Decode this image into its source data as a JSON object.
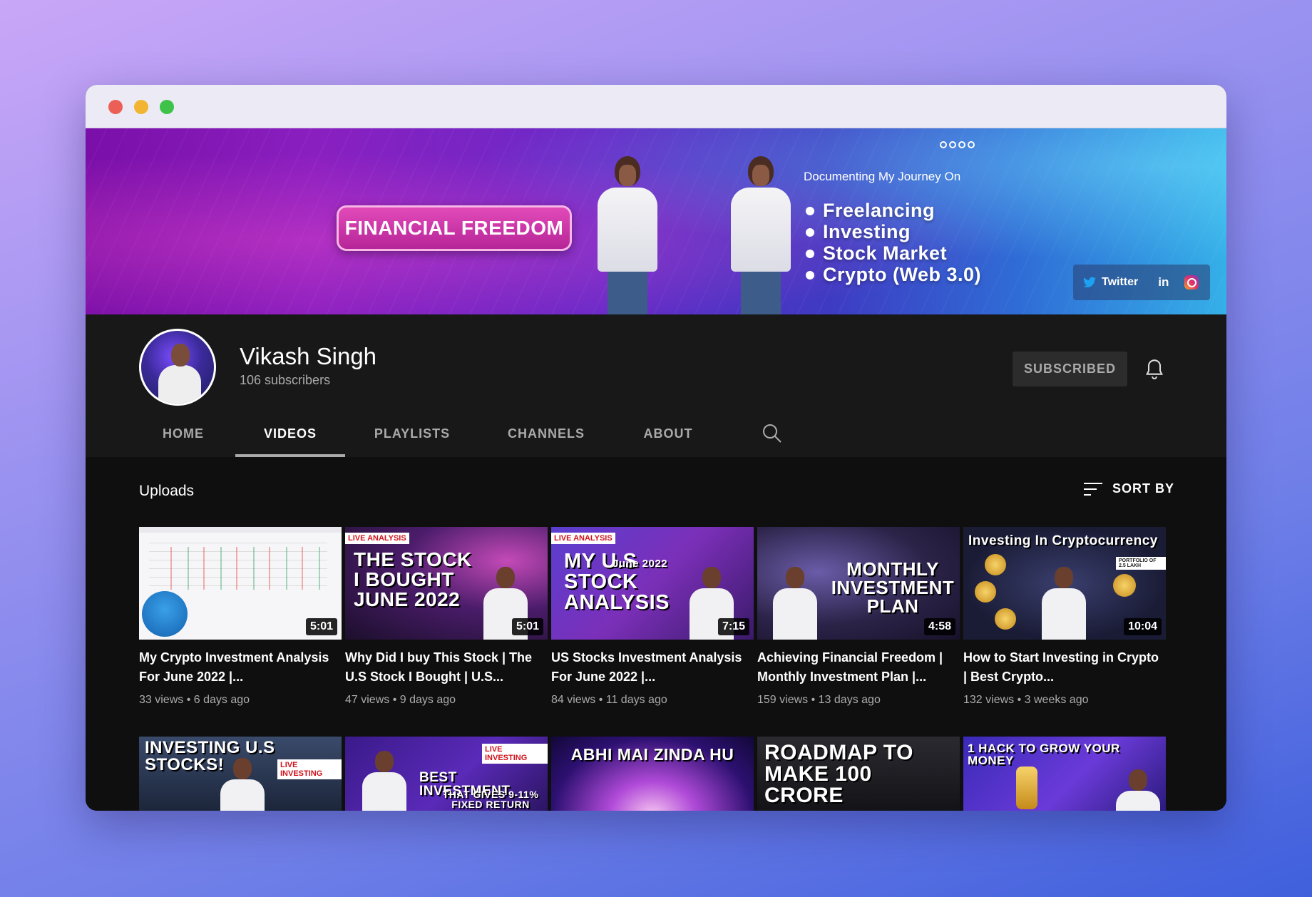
{
  "banner": {
    "headline": "FINANCIAL FREEDOM",
    "journey_title": "Documenting My Journey On",
    "journey_items": [
      "Freelancing",
      "Investing",
      "Stock Market",
      "Crypto (Web 3.0)"
    ],
    "social": {
      "twitter": "Twitter",
      "linkedin": "in"
    }
  },
  "channel": {
    "name": "Vikash Singh",
    "subscribers": "106 subscribers",
    "subscribe_label": "SUBSCRIBED"
  },
  "tabs": [
    "HOME",
    "VIDEOS",
    "PLAYLISTS",
    "CHANNELS",
    "ABOUT"
  ],
  "active_tab": "VIDEOS",
  "content": {
    "section_title": "Uploads",
    "sort_label": "SORT BY"
  },
  "videos": [
    {
      "title": "My Crypto Investment Analysis For June 2022 |...",
      "views": "33 views",
      "age": "6 days ago",
      "duration": "5:01"
    },
    {
      "title": "Why Did I buy This Stock | The U.S Stock I Bought | U.S...",
      "views": "47 views",
      "age": "9 days ago",
      "duration": "5:01",
      "tag": "LIVE ANALYSIS",
      "thumb_text": "THE STOCK I BOUGHT JUNE 2022"
    },
    {
      "title": "US Stocks Investment Analysis For June 2022 |...",
      "views": "84 views",
      "age": "11 days ago",
      "duration": "7:15",
      "tag": "LIVE ANALYSIS",
      "thumb_text": "MY U.S STOCK ANALYSIS",
      "thumb_sub": "June 2022"
    },
    {
      "title": "Achieving Financial Freedom | Monthly Investment Plan |...",
      "views": "159 views",
      "age": "13 days ago",
      "duration": "4:58",
      "thumb_text": "MONTHLY INVESTMENT PLAN"
    },
    {
      "title": "How to Start Investing in Crypto | Best Crypto...",
      "views": "132 views",
      "age": "3 weeks ago",
      "duration": "10:04",
      "thumb_text": "Investing In Cryptocurrency",
      "thumb_sub": "PORTFOLIO OF 2.5 LAKH"
    }
  ],
  "videos_row2": [
    {
      "thumb_text": "INVESTING U.S STOCKS!",
      "tag": "LIVE INVESTING"
    },
    {
      "thumb_text": "BEST INVESTMENT",
      "thumb_sub": "THAT GIVES 9-11% FIXED RETURN",
      "tag": "LIVE INVESTING"
    },
    {
      "thumb_text": "ABHI MAI ZINDA HU"
    },
    {
      "thumb_text": "ROADMAP TO MAKE 100 CRORE"
    },
    {
      "thumb_text": "1 HACK TO GROW YOUR MONEY"
    }
  ]
}
